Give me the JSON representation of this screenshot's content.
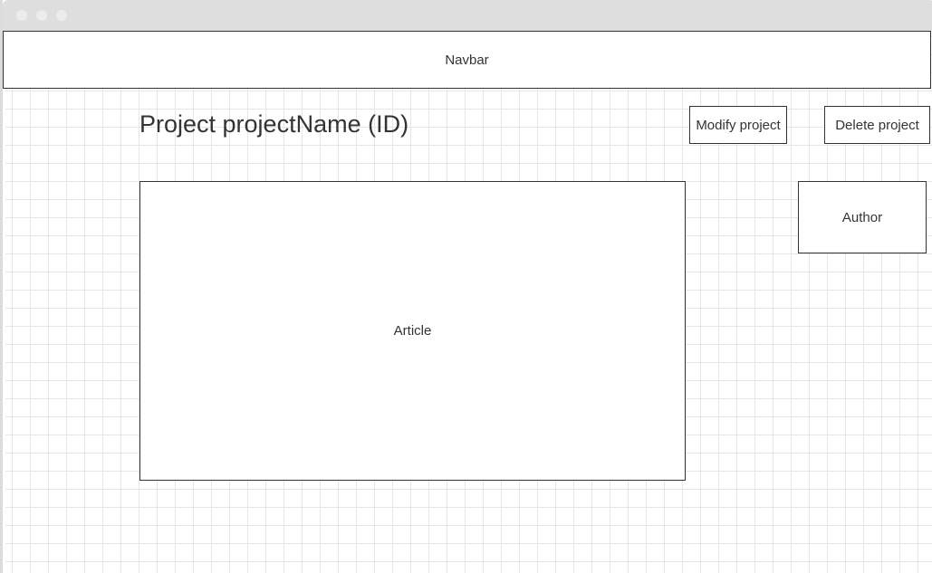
{
  "navbar": {
    "label": "Navbar"
  },
  "header": {
    "title": "Project projectName (ID)",
    "modify_label": "Modify project",
    "delete_label": "Delete project"
  },
  "main": {
    "article_label": "Article",
    "author_label": "Author"
  }
}
